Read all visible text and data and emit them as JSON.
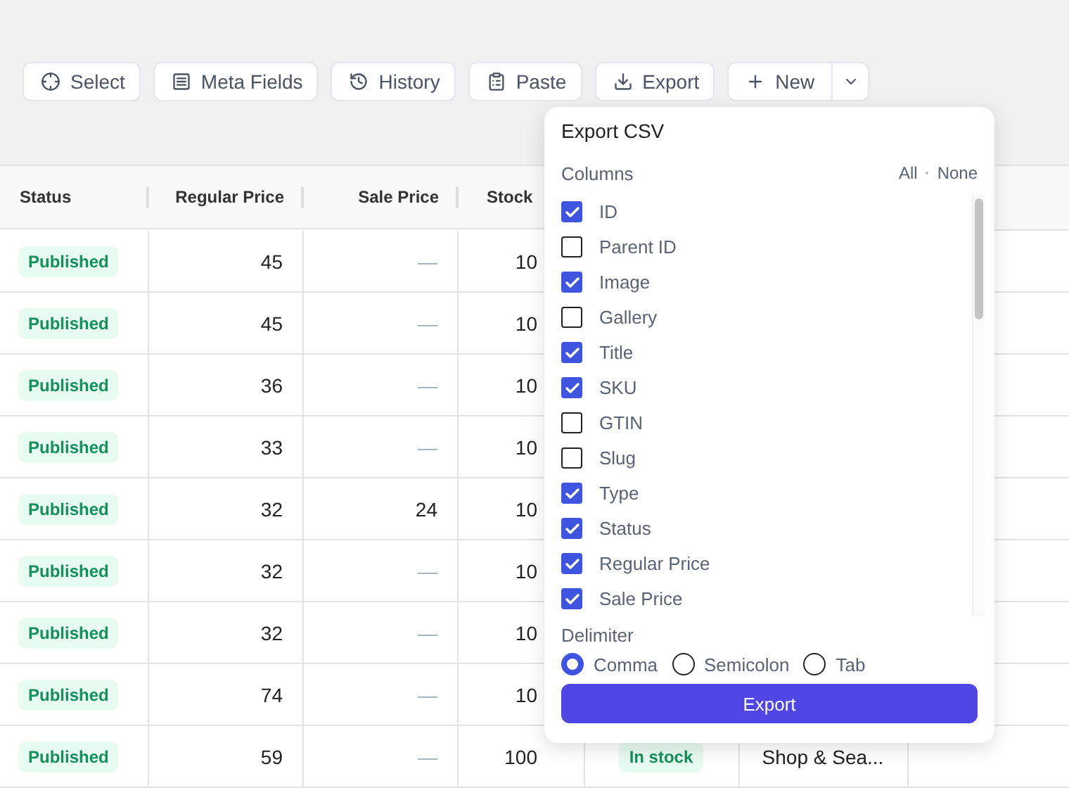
{
  "toolbar": {
    "buttons": [
      {
        "kind": "select",
        "label": "Select"
      },
      {
        "kind": "meta",
        "label": "Meta Fields"
      },
      {
        "kind": "history",
        "label": "History"
      },
      {
        "kind": "paste",
        "label": "Paste"
      },
      {
        "kind": "export",
        "label": "Export"
      },
      {
        "kind": "new",
        "label": "New"
      }
    ]
  },
  "table": {
    "columns": [
      "Status",
      "Regular Price",
      "Sale Price",
      "Stock"
    ],
    "rows": [
      {
        "status": "Published",
        "regular_price": "45",
        "sale_price": "—",
        "stock": "10"
      },
      {
        "status": "Published",
        "regular_price": "45",
        "sale_price": "—",
        "stock": "10"
      },
      {
        "status": "Published",
        "regular_price": "36",
        "sale_price": "—",
        "stock": "10"
      },
      {
        "status": "Published",
        "regular_price": "33",
        "sale_price": "—",
        "stock": "10"
      },
      {
        "status": "Published",
        "regular_price": "32",
        "sale_price": "24",
        "stock": "10"
      },
      {
        "status": "Published",
        "regular_price": "32",
        "sale_price": "—",
        "stock": "10"
      },
      {
        "status": "Published",
        "regular_price": "32",
        "sale_price": "—",
        "stock": "10"
      },
      {
        "status": "Published",
        "regular_price": "74",
        "sale_price": "—",
        "stock": "10"
      },
      {
        "status": "Published",
        "regular_price": "59",
        "sale_price": "—",
        "stock": "100",
        "column_5": "In stock",
        "column_6": "Shop & Sea..."
      }
    ]
  },
  "export_popup": {
    "title": "Export CSV",
    "columns_label": "Columns",
    "select_all": "All",
    "select_none": "None",
    "columns": [
      {
        "label": "ID",
        "checked": true
      },
      {
        "label": "Parent ID",
        "checked": false
      },
      {
        "label": "Image",
        "checked": true
      },
      {
        "label": "Gallery",
        "checked": false
      },
      {
        "label": "Title",
        "checked": true
      },
      {
        "label": "SKU",
        "checked": true
      },
      {
        "label": "GTIN",
        "checked": false
      },
      {
        "label": "Slug",
        "checked": false
      },
      {
        "label": "Type",
        "checked": true
      },
      {
        "label": "Status",
        "checked": true
      },
      {
        "label": "Regular Price",
        "checked": true
      },
      {
        "label": "Sale Price",
        "checked": true
      }
    ],
    "delimiter_label": "Delimiter",
    "delimiters": [
      {
        "label": "Comma",
        "selected": true
      },
      {
        "label": "Semicolon",
        "selected": false
      },
      {
        "label": "Tab",
        "selected": false
      }
    ],
    "button": "Export"
  }
}
